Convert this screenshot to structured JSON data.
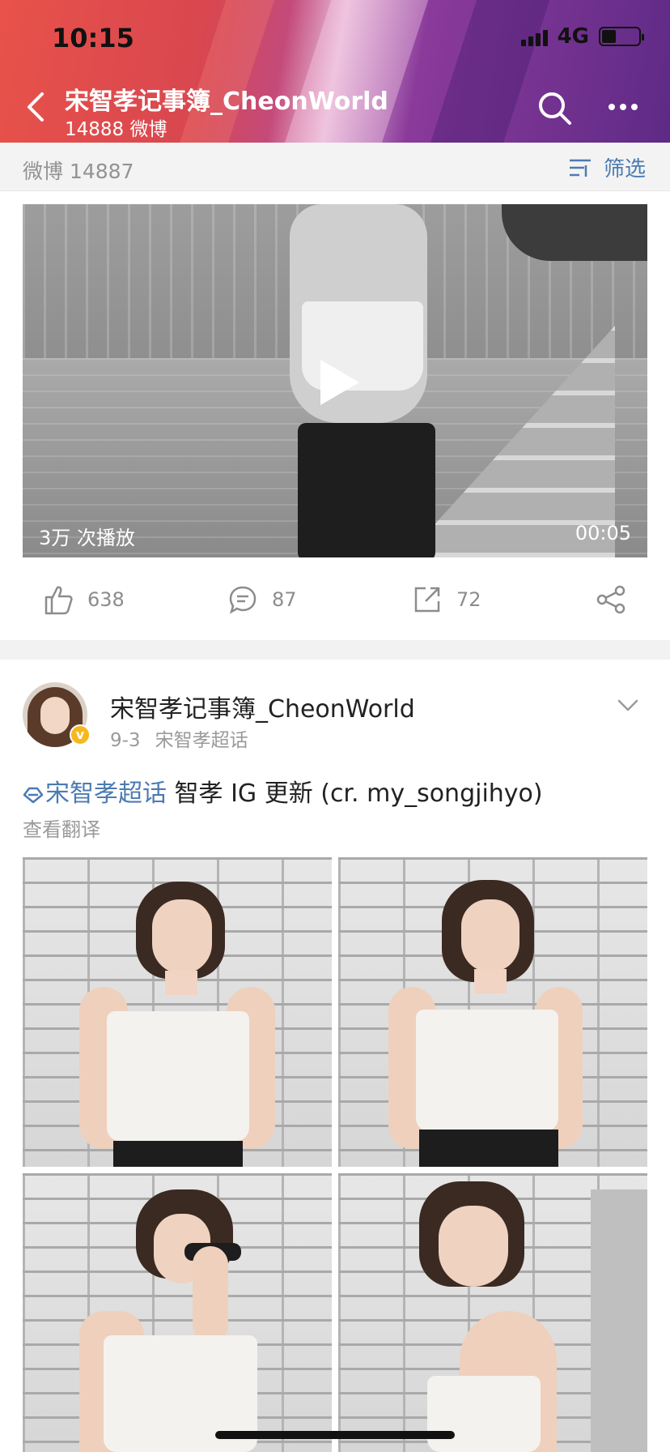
{
  "status_bar": {
    "time": "10:15",
    "network": "4G"
  },
  "header": {
    "title": "宋智孝记事簿_CheonWorld",
    "subtitle": "14888 微博"
  },
  "filter_bar": {
    "count_label": "微博 14887",
    "filter_label": "筛选"
  },
  "video": {
    "plays": "3万 次播放",
    "duration": "00:05"
  },
  "actions": {
    "likes": "638",
    "comments": "87",
    "reposts": "72"
  },
  "post": {
    "author": "宋智孝记事簿_CheonWorld",
    "date": "9-3",
    "source": "宋智孝超话",
    "topic": "宋智孝超话",
    "text": " 智孝 IG 更新 (cr. my_songjihyo)",
    "translate_label": "查看翻译"
  },
  "colors": {
    "link_blue": "#4c7bb1",
    "meta_gray": "#9a9a9a",
    "verified_gold": "#f6b81c"
  }
}
